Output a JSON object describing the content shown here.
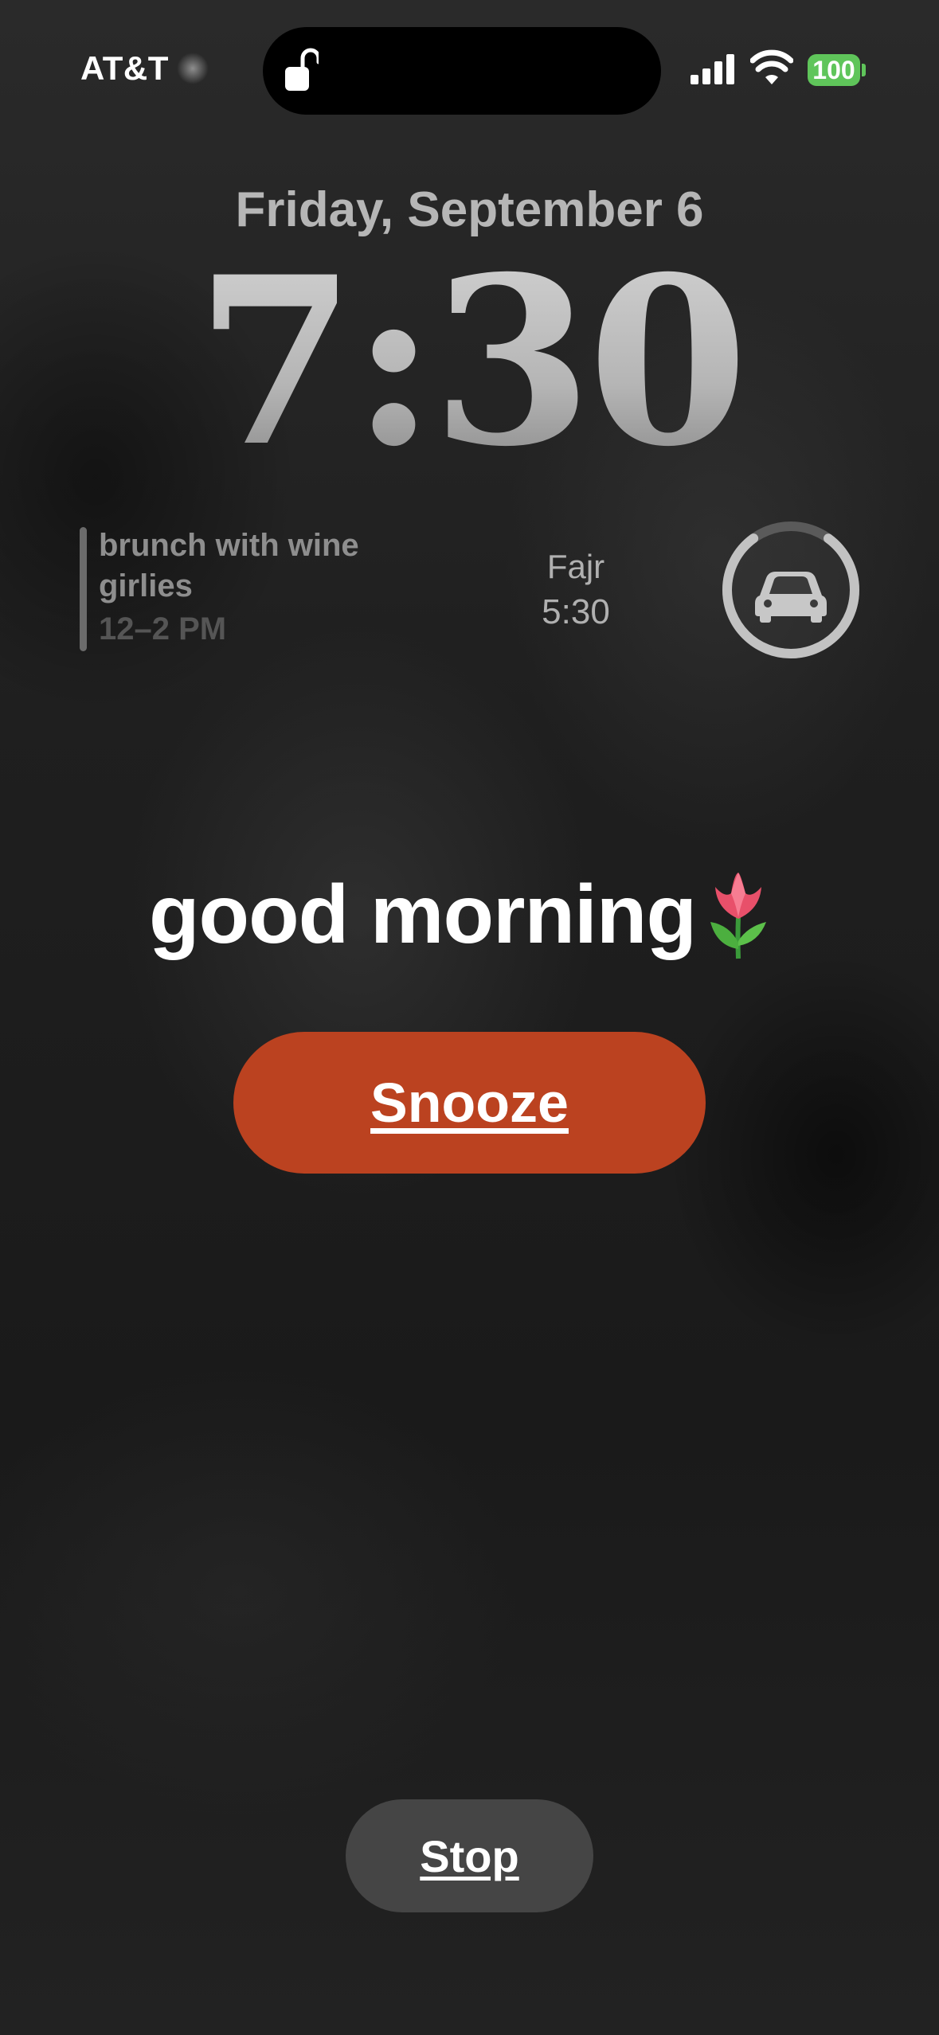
{
  "status_bar": {
    "carrier": "AT&T",
    "battery": "100",
    "battery_color": "#5fc55a",
    "icons": [
      "lock-open-icon",
      "cellular-signal-icon",
      "wifi-icon",
      "battery-icon"
    ]
  },
  "lock_screen": {
    "date": "Friday, September 6",
    "time": "7:30"
  },
  "widgets": {
    "calendar": {
      "title": "brunch with wine girlies",
      "time": "12–2 PM"
    },
    "prayer": {
      "name": "Fajr",
      "time": "5:30"
    },
    "car": {
      "icon": "car-icon",
      "charge_fraction": 0.8
    }
  },
  "alarm": {
    "label": "good morning",
    "emoji_icon": "tulip-icon",
    "snooze_label": "Snooze",
    "snooze_color": "#bb4220",
    "stop_label": "Stop"
  }
}
